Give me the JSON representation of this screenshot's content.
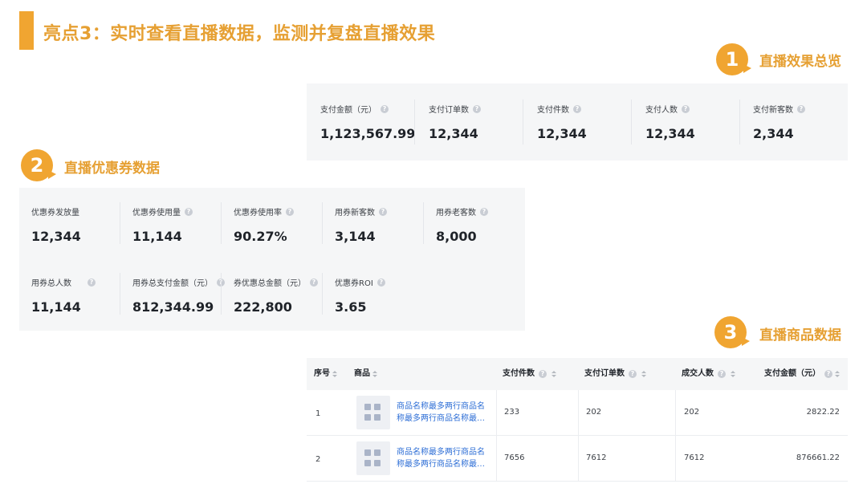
{
  "page_title": "亮点3：实时查看直播数据，监测并复盘直播效果",
  "sections": {
    "overview": {
      "number": "1",
      "title": "直播效果总览"
    },
    "coupon": {
      "number": "2",
      "title": "直播优惠券数据"
    },
    "products": {
      "number": "3",
      "title": "直播商品数据"
    }
  },
  "overview_stats": [
    {
      "label": "支付金额（元）",
      "value": "1,123,567.99",
      "help_icon": "question-circle-icon"
    },
    {
      "label": "支付订单数",
      "value": "12,344",
      "help_icon": "question-circle-icon"
    },
    {
      "label": "支付件数",
      "value": "12,344",
      "help_icon": "question-circle-icon"
    },
    {
      "label": "支付人数",
      "value": "12,344",
      "help_icon": "question-circle-icon"
    },
    {
      "label": "支付新客数",
      "value": "2,344",
      "help_icon": "question-circle-icon"
    }
  ],
  "coupon_stats_row1": [
    {
      "label": "优惠券发放量",
      "value": "12,344"
    },
    {
      "label": "优惠券使用量",
      "value": "11,144"
    },
    {
      "label": "优惠券使用率",
      "value": "90.27%"
    },
    {
      "label": "用券新客数",
      "value": "3,144"
    },
    {
      "label": "用券老客数",
      "value": "8,000"
    }
  ],
  "coupon_stats_row2": [
    {
      "label": "用券总人数",
      "value": "11,144"
    },
    {
      "label": "用券总支付金额（元）",
      "value": "812,344.99"
    },
    {
      "label": "券优惠总金额（元）",
      "value": "222,800"
    },
    {
      "label": "优惠券ROI",
      "value": "3.65"
    }
  ],
  "product_table": {
    "columns": [
      "序号",
      "商品",
      "支付件数",
      "支付订单数",
      "成交人数",
      "支付金额（元）"
    ],
    "rows": [
      {
        "index": "1",
        "name": "商品名称最多两行商品名称最多两行商品名称最…",
        "qty": "233",
        "orders": "202",
        "buyers": "202",
        "amount": "2822.22"
      },
      {
        "index": "2",
        "name": "商品名称最多两行商品名称最多两行商品名称最…",
        "qty": "7656",
        "orders": "7612",
        "buyers": "7612",
        "amount": "876661.22"
      }
    ]
  },
  "colors": {
    "accent": "#f0a531",
    "link": "#2f6fd6",
    "panel_bg": "#f5f6f7"
  }
}
